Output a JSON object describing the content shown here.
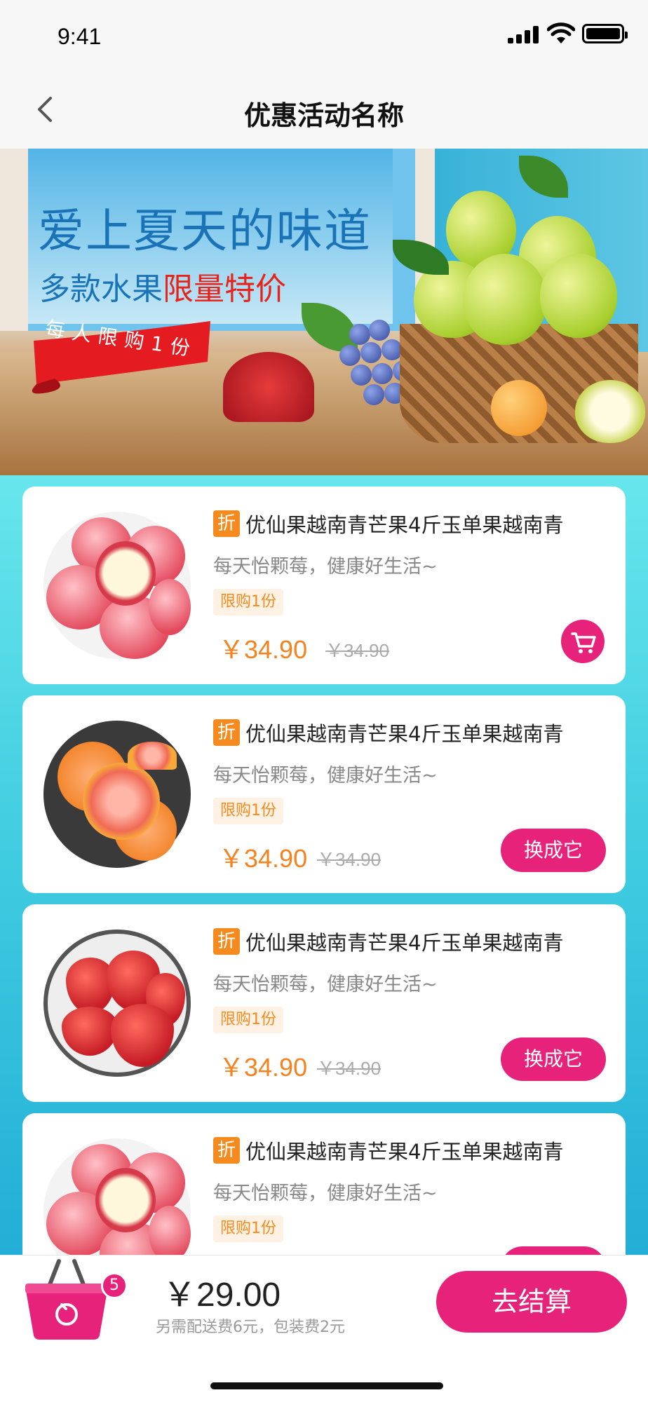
{
  "status_bar": {
    "time": "9:41"
  },
  "nav": {
    "title": "优惠活动名称"
  },
  "banner": {
    "headline": "爱上夏天的味道",
    "subline_prefix": "多款水果",
    "subline_highlight": "限量特价",
    "ribbon": "每人限购1份"
  },
  "products": [
    {
      "tag": "折",
      "title": "优仙果越南青芒果4斤玉单果越南青",
      "desc": "每天怡颗莓，健康好生活~",
      "limit": "限购1份",
      "price": "￥34.90",
      "original_price": "￥34.90",
      "action": "cart",
      "action_label": ""
    },
    {
      "tag": "折",
      "title": "优仙果越南青芒果4斤玉单果越南青",
      "desc": "每天怡颗莓，健康好生活~",
      "limit": "限购1份",
      "price": "￥34.90",
      "original_price": "￥34.90",
      "action": "swap",
      "action_label": "换成它"
    },
    {
      "tag": "折",
      "title": "优仙果越南青芒果4斤玉单果越南青",
      "desc": "每天怡颗莓，健康好生活~",
      "limit": "限购1份",
      "price": "￥34.90",
      "original_price": "￥34.90",
      "action": "swap",
      "action_label": "换成它"
    },
    {
      "tag": "折",
      "title": "优仙果越南青芒果4斤玉单果越南青",
      "desc": "每天怡颗莓，健康好生活~",
      "limit": "限购1份",
      "price": "",
      "original_price": "",
      "action": "swap",
      "action_label": ""
    }
  ],
  "cart_bar": {
    "badge_count": "5",
    "total": "￥29.00",
    "fees": "另需配送费6元，包装费2元",
    "checkout_label": "去结算"
  },
  "colors": {
    "accent": "#e6227a",
    "price": "#f5821f",
    "list_bg_top": "#67e6ec",
    "list_bg_bottom": "#22aed6"
  }
}
